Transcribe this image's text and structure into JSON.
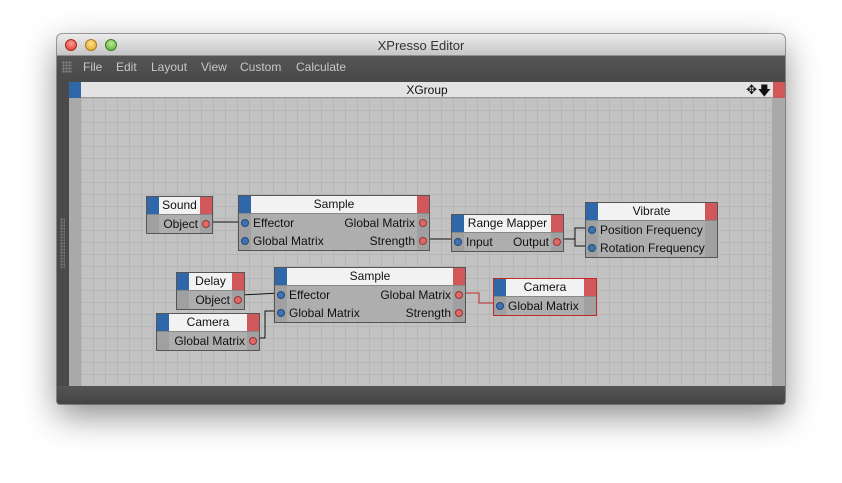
{
  "window": {
    "title": "XPresso Editor"
  },
  "menu": [
    "File",
    "Edit",
    "Layout",
    "View",
    "Custom",
    "Calculate"
  ],
  "panel": {
    "title": "XGroup",
    "move_icon": "move-icon",
    "pin_icon": "down-arrow-icon"
  },
  "nodes": {
    "sound": {
      "title": "Sound",
      "out": [
        "Object"
      ]
    },
    "sample1": {
      "title": "Sample",
      "in": [
        "Effector",
        "Global Matrix"
      ],
      "out": [
        "Global Matrix",
        "Strength"
      ]
    },
    "range_mapper": {
      "title": "Range Mapper",
      "in": [
        "Input"
      ],
      "out": [
        "Output"
      ]
    },
    "vibrate": {
      "title": "Vibrate",
      "in": [
        "Position Frequency",
        "Rotation Frequency"
      ]
    },
    "delay": {
      "title": "Delay",
      "out": [
        "Object"
      ]
    },
    "sample2": {
      "title": "Sample",
      "in": [
        "Effector",
        "Global Matrix"
      ],
      "out": [
        "Global Matrix",
        "Strength"
      ]
    },
    "camera_out": {
      "title": "Camera",
      "in": [
        "Global Matrix"
      ]
    },
    "camera_src": {
      "title": "Camera",
      "out": [
        "Global Matrix"
      ]
    }
  },
  "colors": {
    "port_in": "#3d72b5",
    "port_out": "#e06868",
    "wire": "#111111",
    "wire_selected": "#c0282a",
    "header_blue": "#2f67a8",
    "header_red": "#d0585a"
  }
}
